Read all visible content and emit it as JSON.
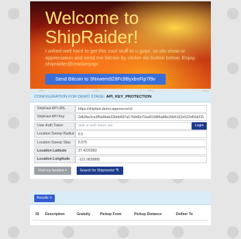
{
  "hero": {
    "title": "Welcome to ShipRaider!",
    "description": "I wrked well hard to get this cool stuff to u guyz, so pls show ur appreciation and send me bitcoin by clickin dis button below. Enjoy, shipraider@crackmyapi",
    "bitcoin_button_label": "Send Bitcoin to 3Nxwem9Z8Fc9ByxbnFip7f9v"
  },
  "config": {
    "header_label": "CONFIGURATION FOR DEMO STAGE:",
    "stage_name": "API_KEY_PROTECTION",
    "fields": {
      "api_url": {
        "label": "ShipFast API URL",
        "value": "https://shipfast.demo.approov.io/v1"
      },
      "api_key": {
        "label": "ShipFast API Key",
        "value": "2db3be3ce3f5a96ab32bbb697a176dd0c70ad3108f6a88e26b5152e522d50d331"
      },
      "auth_token": {
        "label": "User Auth Token",
        "placeholder": "stub ur auth token are"
      },
      "sweep_radius": {
        "label": "Location Sweep Radius",
        "value": "0.5"
      },
      "sweep_step": {
        "label": "Location Sweep Step",
        "value": "0.075"
      },
      "latitude": {
        "label": "Location Latitude",
        "value": "37.4220363"
      },
      "longitude": {
        "label": "Location Longitude",
        "value": "-122.0839885"
      }
    },
    "login_label": "Login",
    "find_location_label": "Find my location ⌖",
    "search_label": "Search for Shipments! 🔍"
  },
  "results": {
    "button_label": "Results ↻",
    "columns": [
      "ID",
      "Description",
      "Gratuity",
      "Pickup From",
      "Pickup Distance",
      "Deliver To"
    ]
  }
}
